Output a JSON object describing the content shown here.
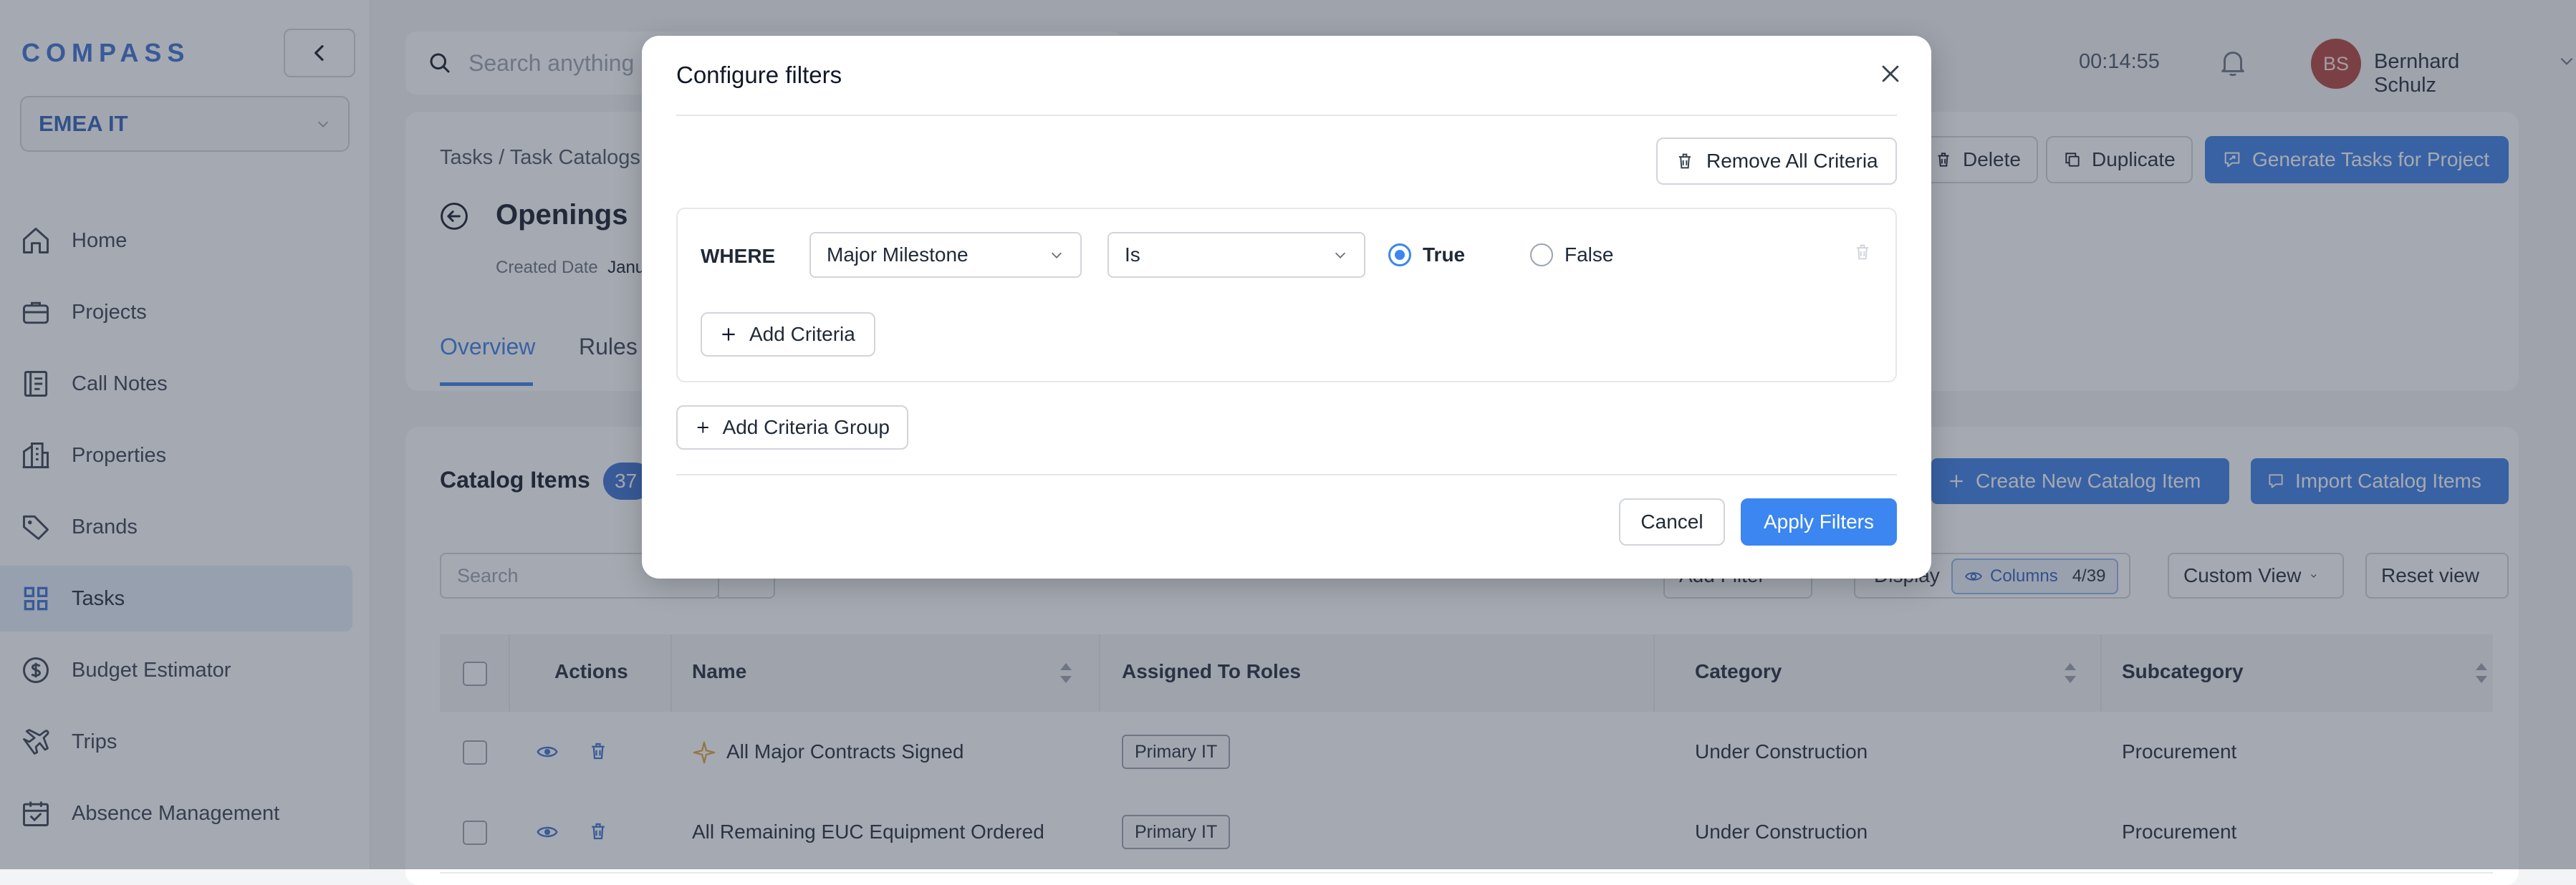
{
  "sidebar": {
    "logo": "COMPASS",
    "workspace": "EMEA IT",
    "items": [
      {
        "label": "Home",
        "icon": "home-icon"
      },
      {
        "label": "Projects",
        "icon": "briefcase-icon"
      },
      {
        "label": "Call Notes",
        "icon": "notes-icon"
      },
      {
        "label": "Properties",
        "icon": "building-icon"
      },
      {
        "label": "Brands",
        "icon": "tag-icon"
      },
      {
        "label": "Tasks",
        "icon": "grid-icon",
        "active": true
      },
      {
        "label": "Budget Estimator",
        "icon": "dollar-icon"
      },
      {
        "label": "Trips",
        "icon": "plane-icon"
      },
      {
        "label": "Absence Management",
        "icon": "calendar-icon"
      }
    ]
  },
  "topbar": {
    "search_placeholder": "Search anything",
    "timer": "00:14:55",
    "user_initials": "BS",
    "user_name": "Bernhard Schulz"
  },
  "header": {
    "breadcrumb": "Tasks  /  Task Catalogs",
    "title": "Openings",
    "created_label": "Created Date",
    "created_value": "Janu",
    "delete_label": "Delete",
    "duplicate_label": "Duplicate",
    "generate_label": "Generate Tasks for Project",
    "tabs": [
      "Overview",
      "Rules"
    ]
  },
  "catalog": {
    "title": "Catalog Items",
    "count": "37",
    "search_placeholder": "Search",
    "create_label": "Create New Catalog Item",
    "import_label": "Import Catalog Items",
    "add_filter_label": "Add Filter",
    "display_label": "Display",
    "columns_label": "Columns",
    "columns_count": "4/39",
    "custom_view_label": "Custom View",
    "reset_view_label": "Reset view",
    "columns": [
      "Actions",
      "Name",
      "Assigned To Roles",
      "Category",
      "Subcategory"
    ],
    "rows": [
      {
        "name": "All Major Contracts Signed",
        "role": "Primary IT",
        "category": "Under Construction",
        "subcategory": "Procurement",
        "milestone": true
      },
      {
        "name": "All Remaining EUC Equipment Ordered",
        "role": "Primary IT",
        "category": "Under Construction",
        "subcategory": "Procurement",
        "milestone": false
      }
    ]
  },
  "modal": {
    "title": "Configure filters",
    "remove_all_label": "Remove All Criteria",
    "where_label": "WHERE",
    "field_value": "Major Milestone",
    "operator_value": "Is",
    "true_label": "True",
    "false_label": "False",
    "selected": "True",
    "add_criteria_label": "Add Criteria",
    "add_group_label": "Add Criteria Group",
    "cancel_label": "Cancel",
    "apply_label": "Apply Filters"
  },
  "colors": {
    "accent": "#3b86f0",
    "brand": "#3b6fd1",
    "avatar": "#b3413b"
  }
}
